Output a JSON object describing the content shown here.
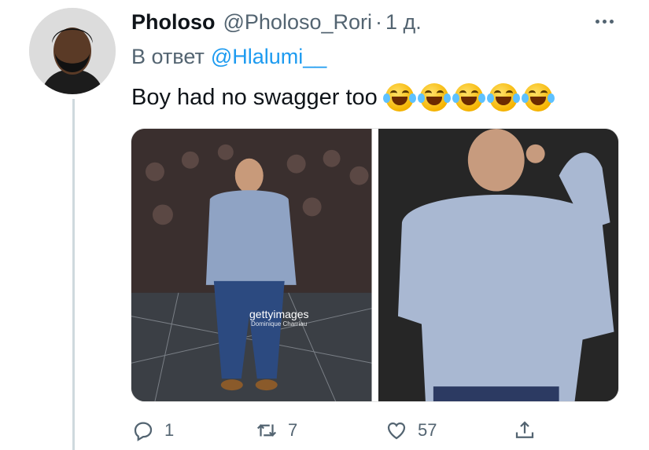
{
  "tweet": {
    "display_name": "Pholoso",
    "handle": "@Pholoso_Rori",
    "separator": "·",
    "time": "1 д.",
    "reply_prefix": "В ответ",
    "reply_to": "@Hlalumi__",
    "text": "Boy had no swagger too",
    "emoji": [
      "joy-emoji",
      "joy-emoji",
      "joy-emoji",
      "joy-emoji",
      "joy-emoji"
    ],
    "more_icon": "more-horizontal-icon"
  },
  "media": {
    "watermark": "gettyimages",
    "watermark_credit": "Dominique Charriau"
  },
  "actions": {
    "reply_count": "1",
    "retweet_count": "7",
    "like_count": "57",
    "icons": [
      "reply-icon",
      "retweet-icon",
      "like-icon",
      "share-icon"
    ]
  },
  "colors": {
    "text_primary": "#0f1419",
    "text_secondary": "#536471",
    "link": "#1d9bf0",
    "thread_line": "#cfd9de"
  }
}
